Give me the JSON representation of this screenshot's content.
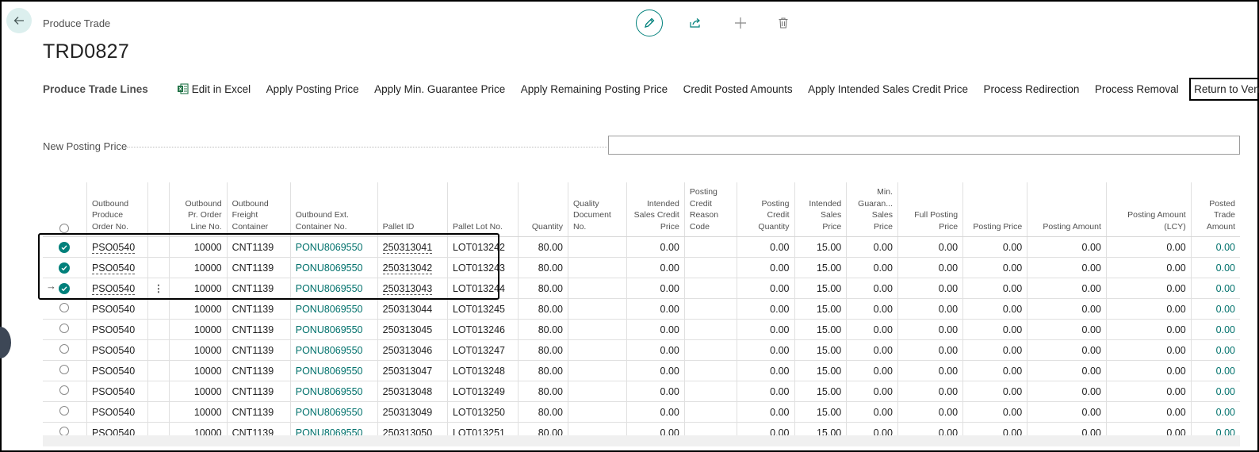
{
  "header": {
    "breadcrumb": "Produce Trade",
    "title": "TRD0827"
  },
  "top_actions": [
    "edit-icon",
    "share-icon",
    "plus-icon",
    "delete-icon"
  ],
  "action_bar": {
    "title": "Produce Trade Lines",
    "items": [
      "Edit in Excel",
      "Apply Posting Price",
      "Apply Min. Guarantee Price",
      "Apply Remaining Posting Price",
      "Credit Posted Amounts",
      "Apply Intended Sales Credit Price",
      "Process Redirection",
      "Process Removal",
      "Return to Vendor"
    ],
    "more": "···"
  },
  "field": {
    "label": "New Posting Price",
    "value": ""
  },
  "table": {
    "columns": [
      "Outbound Produce Order No.",
      "Outbound Pr. Order Line No.",
      "Outbound Freight Container",
      "Outbound Ext. Container No.",
      "Pallet ID",
      "Pallet Lot No.",
      "Quantity",
      "Quality Document No.",
      "Intended Sales Credit Price",
      "Posting Credit Reason Code",
      "Posting Credit Quantity",
      "Intended Sales Price",
      "Min. Guaran... Sales Price",
      "Full Posting Price",
      "Posting Price",
      "Posting Amount",
      "Posting Amount (LCY)",
      "Posted Trade Amount"
    ],
    "rows": [
      {
        "selected": true,
        "order": "PSO0540",
        "line": "10000",
        "container": "CNT1139",
        "ext": "PONU8069550",
        "pallet": "250313041",
        "lot": "LOT013242",
        "qty": "80.00",
        "qdoc": "",
        "iscp": "0.00",
        "reason": "",
        "pcq": "0.00",
        "isp": "15.00",
        "mg": "0.00",
        "fpp": "0.00",
        "pp": "0.00",
        "pa": "0.00",
        "palcy": "0.00",
        "pta": "0.00"
      },
      {
        "selected": true,
        "order": "PSO0540",
        "line": "10000",
        "container": "CNT1139",
        "ext": "PONU8069550",
        "pallet": "250313042",
        "lot": "LOT013243",
        "qty": "80.00",
        "qdoc": "",
        "iscp": "0.00",
        "reason": "",
        "pcq": "0.00",
        "isp": "15.00",
        "mg": "0.00",
        "fpp": "0.00",
        "pp": "0.00",
        "pa": "0.00",
        "palcy": "0.00",
        "pta": "0.00"
      },
      {
        "selected": true,
        "order": "PSO0540",
        "line": "10000",
        "container": "CNT1139",
        "ext": "PONU8069550",
        "pallet": "250313043",
        "lot": "LOT013244",
        "qty": "80.00",
        "qdoc": "",
        "iscp": "0.00",
        "reason": "",
        "pcq": "0.00",
        "isp": "15.00",
        "mg": "0.00",
        "fpp": "0.00",
        "pp": "0.00",
        "pa": "0.00",
        "palcy": "0.00",
        "pta": "0.00"
      },
      {
        "selected": false,
        "order": "PSO0540",
        "line": "10000",
        "container": "CNT1139",
        "ext": "PONU8069550",
        "pallet": "250313044",
        "lot": "LOT013245",
        "qty": "80.00",
        "qdoc": "",
        "iscp": "0.00",
        "reason": "",
        "pcq": "0.00",
        "isp": "15.00",
        "mg": "0.00",
        "fpp": "0.00",
        "pp": "0.00",
        "pa": "0.00",
        "palcy": "0.00",
        "pta": "0.00"
      },
      {
        "selected": false,
        "order": "PSO0540",
        "line": "10000",
        "container": "CNT1139",
        "ext": "PONU8069550",
        "pallet": "250313045",
        "lot": "LOT013246",
        "qty": "80.00",
        "qdoc": "",
        "iscp": "0.00",
        "reason": "",
        "pcq": "0.00",
        "isp": "15.00",
        "mg": "0.00",
        "fpp": "0.00",
        "pp": "0.00",
        "pa": "0.00",
        "palcy": "0.00",
        "pta": "0.00"
      },
      {
        "selected": false,
        "order": "PSO0540",
        "line": "10000",
        "container": "CNT1139",
        "ext": "PONU8069550",
        "pallet": "250313046",
        "lot": "LOT013247",
        "qty": "80.00",
        "qdoc": "",
        "iscp": "0.00",
        "reason": "",
        "pcq": "0.00",
        "isp": "15.00",
        "mg": "0.00",
        "fpp": "0.00",
        "pp": "0.00",
        "pa": "0.00",
        "palcy": "0.00",
        "pta": "0.00"
      },
      {
        "selected": false,
        "order": "PSO0540",
        "line": "10000",
        "container": "CNT1139",
        "ext": "PONU8069550",
        "pallet": "250313047",
        "lot": "LOT013248",
        "qty": "80.00",
        "qdoc": "",
        "iscp": "0.00",
        "reason": "",
        "pcq": "0.00",
        "isp": "15.00",
        "mg": "0.00",
        "fpp": "0.00",
        "pp": "0.00",
        "pa": "0.00",
        "palcy": "0.00",
        "pta": "0.00"
      },
      {
        "selected": false,
        "order": "PSO0540",
        "line": "10000",
        "container": "CNT1139",
        "ext": "PONU8069550",
        "pallet": "250313048",
        "lot": "LOT013249",
        "qty": "80.00",
        "qdoc": "",
        "iscp": "0.00",
        "reason": "",
        "pcq": "0.00",
        "isp": "15.00",
        "mg": "0.00",
        "fpp": "0.00",
        "pp": "0.00",
        "pa": "0.00",
        "palcy": "0.00",
        "pta": "0.00"
      },
      {
        "selected": false,
        "order": "PSO0540",
        "line": "10000",
        "container": "CNT1139",
        "ext": "PONU8069550",
        "pallet": "250313049",
        "lot": "LOT013250",
        "qty": "80.00",
        "qdoc": "",
        "iscp": "0.00",
        "reason": "",
        "pcq": "0.00",
        "isp": "15.00",
        "mg": "0.00",
        "fpp": "0.00",
        "pp": "0.00",
        "pa": "0.00",
        "palcy": "0.00",
        "pta": "0.00"
      },
      {
        "selected": false,
        "order": "PSO0540",
        "line": "10000",
        "container": "CNT1139",
        "ext": "PONU8069550",
        "pallet": "250313050",
        "lot": "LOT013251",
        "qty": "80.00",
        "qdoc": "",
        "iscp": "0.00",
        "reason": "",
        "pcq": "0.00",
        "isp": "15.00",
        "mg": "0.00",
        "fpp": "0.00",
        "pp": "0.00",
        "pa": "0.00",
        "palcy": "0.00",
        "pta": "0.00"
      }
    ]
  },
  "colors": {
    "accent": "#00807b",
    "link": "#00716c",
    "highlight_border": "#000000"
  }
}
